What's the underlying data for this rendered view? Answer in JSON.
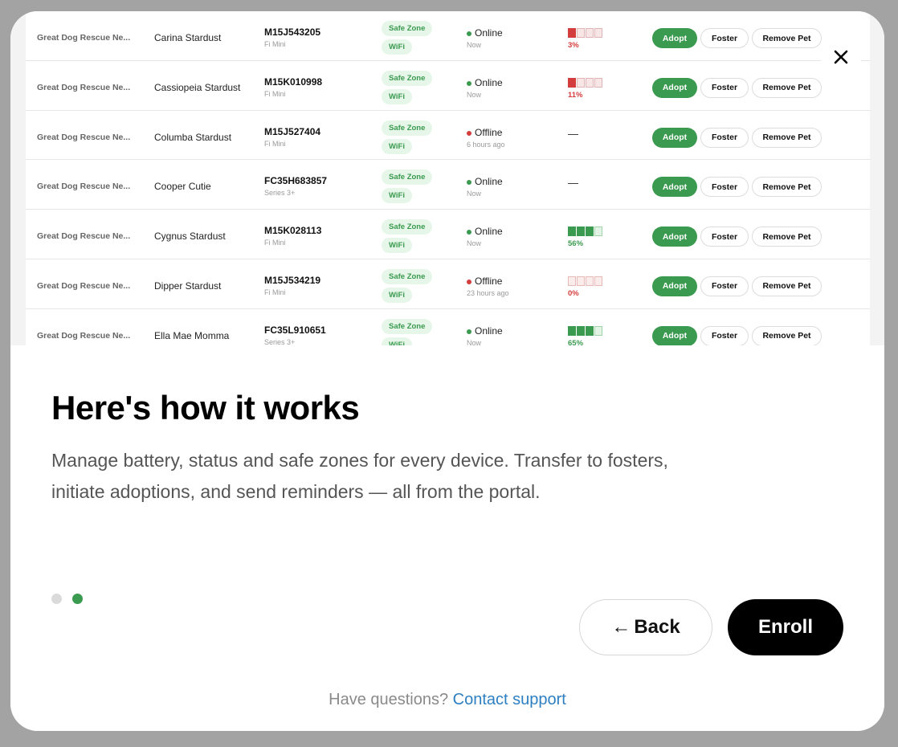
{
  "table": {
    "rows": [
      {
        "org": "Great Dog Rescue Ne...",
        "pet": "Carina Stardust",
        "serial": "M15J543205",
        "model": "Fi Mini",
        "zone": "Safe Zone",
        "network": "WiFi",
        "status": "Online",
        "status_color": "#3a9a4f",
        "last_seen": "Now",
        "battery_fraction": 0.03,
        "battery_label": "3%"
      },
      {
        "org": "Great Dog Rescue Ne...",
        "pet": "Cassiopeia Stardust",
        "serial": "M15K010998",
        "model": "Fi Mini",
        "zone": "Safe Zone",
        "network": "WiFi",
        "status": "Online",
        "status_color": "#3a9a4f",
        "last_seen": "Now",
        "battery_fraction": 0.11,
        "battery_label": "11%"
      },
      {
        "org": "Great Dog Rescue Ne...",
        "pet": "Columba Stardust",
        "serial": "M15J527404",
        "model": "Fi Mini",
        "zone": "Safe Zone",
        "network": "WiFi",
        "status": "Offline",
        "status_color": "#d43d3d",
        "last_seen": "6 hours ago",
        "battery_fraction": null,
        "battery_label": "—"
      },
      {
        "org": "Great Dog Rescue Ne...",
        "pet": "Cooper Cutie",
        "serial": "FC35H683857",
        "model": "Series 3+",
        "zone": "Safe Zone",
        "network": "WiFi",
        "status": "Online",
        "status_color": "#3a9a4f",
        "last_seen": "Now",
        "battery_fraction": null,
        "battery_label": "—"
      },
      {
        "org": "Great Dog Rescue Ne...",
        "pet": "Cygnus Stardust",
        "serial": "M15K028113",
        "model": "Fi Mini",
        "zone": "Safe Zone",
        "network": "WiFi",
        "status": "Online",
        "status_color": "#3a9a4f",
        "last_seen": "Now",
        "battery_fraction": 0.56,
        "battery_label": "56%"
      },
      {
        "org": "Great Dog Rescue Ne...",
        "pet": "Dipper Stardust",
        "serial": "M15J534219",
        "model": "Fi Mini",
        "zone": "Safe Zone",
        "network": "WiFi",
        "status": "Offline",
        "status_color": "#d43d3d",
        "last_seen": "23 hours ago",
        "battery_fraction": 0.0,
        "battery_label": "0%"
      },
      {
        "org": "Great Dog Rescue Ne...",
        "pet": "Ella Mae Momma",
        "serial": "FC35L910651",
        "model": "Series 3+",
        "zone": "Safe Zone",
        "network": "WiFi",
        "status": "Online",
        "status_color": "#3a9a4f",
        "last_seen": "Now",
        "battery_fraction": 0.65,
        "battery_label": "65%"
      }
    ],
    "actions": {
      "adopt": "Adopt",
      "foster": "Foster",
      "remove": "Remove Pet"
    }
  },
  "modal": {
    "close_icon": "close-icon",
    "title": "Here's how it works",
    "description": "Manage battery, status and safe zones for every device. Transfer to fosters, initiate adoptions, and send reminders — all from the portal.",
    "pagination": {
      "total": 2,
      "current": 2
    },
    "back_arrow": "←",
    "back_label": "Back",
    "enroll_label": "Enroll",
    "help_text": "Have questions?",
    "help_link": "Contact support"
  },
  "colors": {
    "accent": "#3a9a4f",
    "danger": "#d43d3d",
    "link": "#2e7fc1",
    "primary_button": "#000000"
  }
}
